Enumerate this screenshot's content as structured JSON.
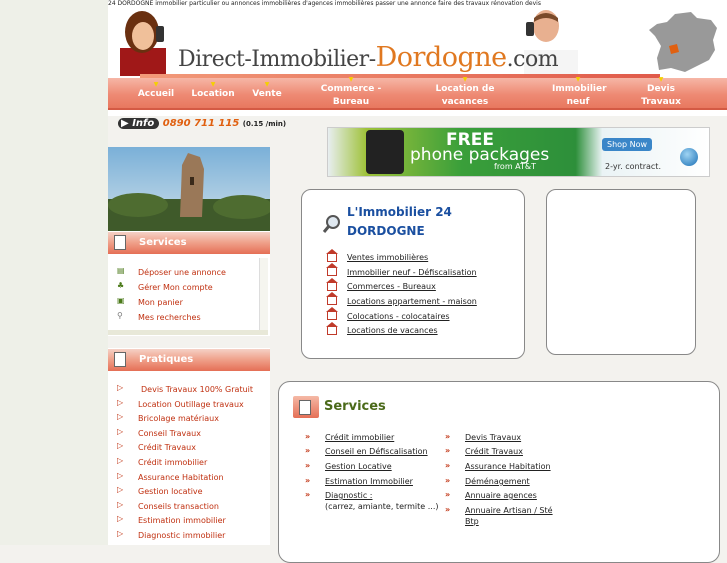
{
  "seo_line": "24 DORDOGNE immobilier particulier ou annonces immobilières d'agences immobilières passer une annonce faire des travaux rénovation devis",
  "logo": {
    "part1": "Direct-Immobilier-",
    "part2": "Dordogne",
    "part3": ".com"
  },
  "nav": [
    {
      "label": "Accueil"
    },
    {
      "label": "Location"
    },
    {
      "label": "Vente"
    },
    {
      "label": "Commerce - Bureau"
    },
    {
      "label": "Location de vacances"
    },
    {
      "label": "Immobilier neuf"
    },
    {
      "label": "Devis Travaux"
    }
  ],
  "info": {
    "badge": "Info",
    "number": "0890 711 115",
    "rate": "(0.15 /min)"
  },
  "ad": {
    "line1": "FREE",
    "line2": "phone packages",
    "line3": "from AT&T",
    "button": "Shop Now",
    "contract": "2-yr. contract."
  },
  "sidebar": {
    "services_heading": "Services",
    "services": [
      {
        "label": "Déposer une annonce",
        "icon": "document-icon"
      },
      {
        "label": "Gérer Mon compte",
        "icon": "user-icon"
      },
      {
        "label": "Mon panier",
        "icon": "cart-icon"
      },
      {
        "label": "Mes recherches",
        "icon": "search-icon"
      }
    ],
    "pratiques_heading": "Pratiques",
    "pratiques": [
      "Devis Travaux 100% Gratuit",
      "Location Outillage travaux",
      "Bricolage matériaux",
      "Conseil Travaux",
      "Crédit Travaux",
      "Crédit immobilier",
      "Assurance Habitation",
      "Gestion locative",
      "Conseils transaction",
      "Estimation immobilier",
      "Diagnostic immobilier"
    ]
  },
  "immobilier_box": {
    "title_line1": "L'Immobilier 24",
    "title_line2": "DORDOGNE",
    "links": [
      "Ventes immobilières",
      "Immobilier neuf - Défiscalisation",
      "Commerces - Bureaux",
      "Locations appartement - maison",
      "Colocations - colocataires",
      "Locations de vacances"
    ]
  },
  "services_box": {
    "title": "Services",
    "col1": [
      "Crédit immobilier",
      "Conseil en Défiscalisation",
      "Gestion Locative",
      "Estimation Immobilier",
      "Diagnostic :"
    ],
    "col1_note": "(carrez, amiante, termite ...)",
    "col2": [
      "Devis Travaux",
      "Crédit Travaux",
      "Assurance Habitation",
      "Déménagement",
      "Annuaire agences",
      "Annuaire Artisan / Sté Btp"
    ]
  },
  "colors": {
    "nav": "#ee8a74",
    "accent": "#e07820",
    "link_red": "#c03010",
    "title_blue": "#1a4fa0",
    "services_green": "#4b6a1a"
  }
}
